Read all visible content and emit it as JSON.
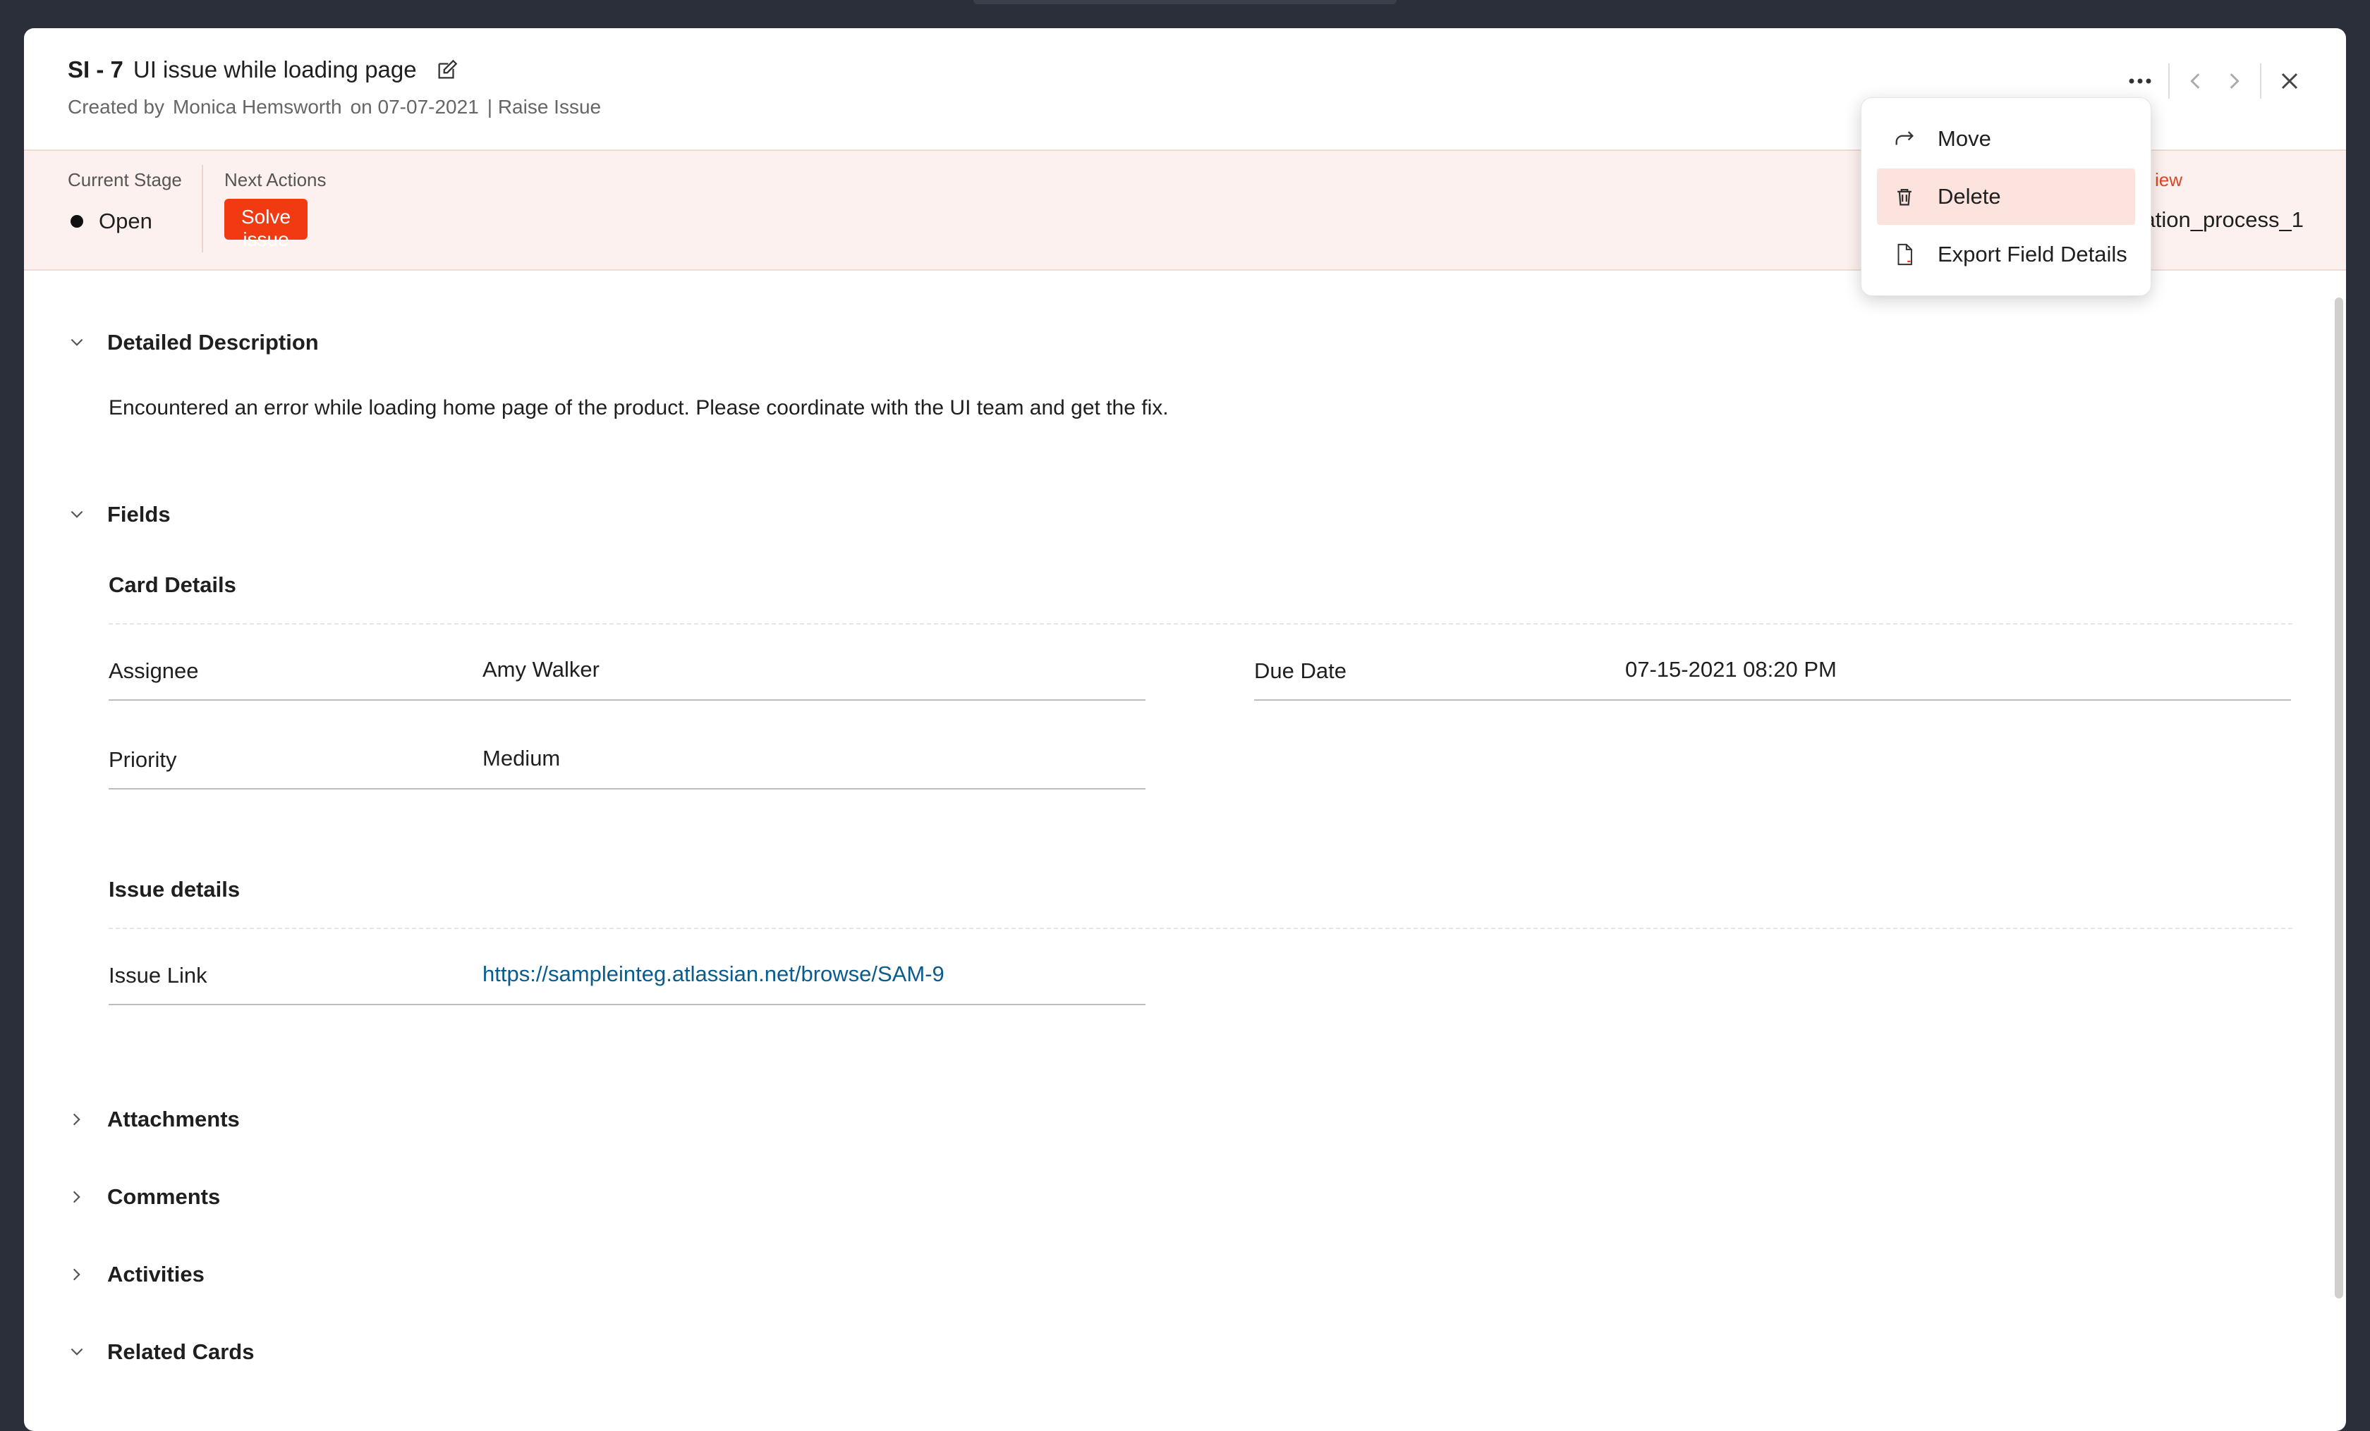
{
  "header": {
    "id": "SI - 7",
    "title": "UI issue while loading page",
    "created_by_label": "Created by",
    "creator": "Monica Hemsworth",
    "date_text": "on 07-07-2021",
    "process": "| Raise Issue"
  },
  "stage_bar": {
    "current_stage_label": "Current Stage",
    "current_stage": "Open",
    "next_actions_label": "Next Actions",
    "action_button": "Solve issue",
    "right_link": "iew",
    "right_value": "ation_process_1"
  },
  "sections": {
    "description_title": "Detailed Description",
    "description_text": "Encountered an error while loading home page of the product. Please coordinate with the UI team and get the fix.",
    "fields_title": "Fields",
    "card_details_title": "Card Details",
    "issue_details_title": "Issue details",
    "attachments_title": "Attachments",
    "comments_title": "Comments",
    "activities_title": "Activities",
    "related_cards_title": "Related Cards"
  },
  "fields": {
    "assignee_label": "Assignee",
    "assignee_value": "Amy Walker",
    "due_date_label": "Due Date",
    "due_date_value": "07-15-2021 08:20 PM",
    "priority_label": "Priority",
    "priority_value": "Medium",
    "issue_link_label": "Issue Link",
    "issue_link_value": "https://sampleinteg.atlassian.net/browse/SAM-9"
  },
  "menu": {
    "items": [
      {
        "label": "Move",
        "icon": "move-icon"
      },
      {
        "label": "Delete",
        "icon": "trash-icon"
      },
      {
        "label": "Export Field Details",
        "icon": "file-icon"
      }
    ]
  },
  "colors": {
    "accent": "#f23a12",
    "stage_bg": "#fdf1ef",
    "link": "#0a5c8c",
    "menu_active": "#fde3de"
  }
}
